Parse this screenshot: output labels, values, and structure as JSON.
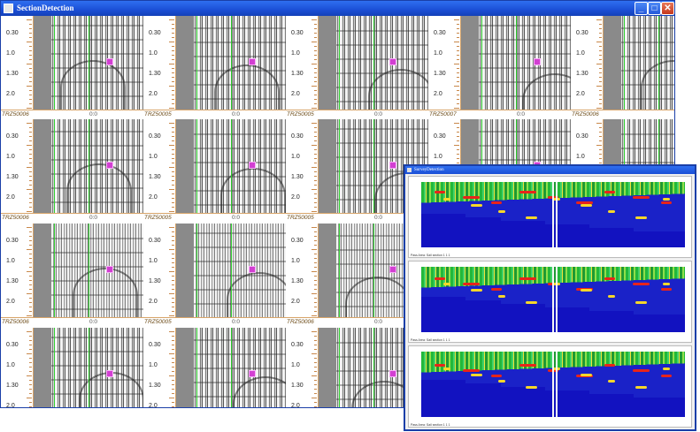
{
  "main_window": {
    "title": "SectionDetection",
    "buttons": {
      "minimize": "_",
      "maximize": "□",
      "close": "✕"
    }
  },
  "depth_ticks": [
    "0.30",
    "1.0",
    "1.30",
    "2.0"
  ],
  "rows": [
    {
      "ids": [
        "TRZ50006",
        "TRZ50005",
        "TRZ50005",
        "TRZ50007",
        "TRZ50006"
      ],
      "coord": "0:0"
    },
    {
      "ids": [
        "TRZ50006",
        "TRZ50005",
        "TRZ50005",
        "TRZ50007",
        "TRZ50006"
      ],
      "coord": "0:0"
    },
    {
      "ids": [
        "TRZ50006",
        "TRZ50005",
        "TRZ50006"
      ],
      "coord": "0:0"
    },
    {
      "ids": [
        "",
        "",
        ""
      ],
      "coord": ""
    }
  ],
  "overlay_window": {
    "title": "SurveyDetection",
    "panels": [
      {
        "caption": "Pass Area: Sail section 1 1 1"
      },
      {
        "caption": "Pass Area: Sail section 1 1 1"
      },
      {
        "caption": "Pass Area: Sail section 1 1 1"
      }
    ],
    "colors": {
      "background": "#1212c0",
      "signal_low": "#22b83a",
      "signal_mid": "#f2e23a",
      "signal_high": "#e8241a"
    }
  },
  "colors": {
    "titlebar": "#1b4fd6",
    "trace_marker": "#d23fd2",
    "grid_line": "#2fcf2f"
  }
}
